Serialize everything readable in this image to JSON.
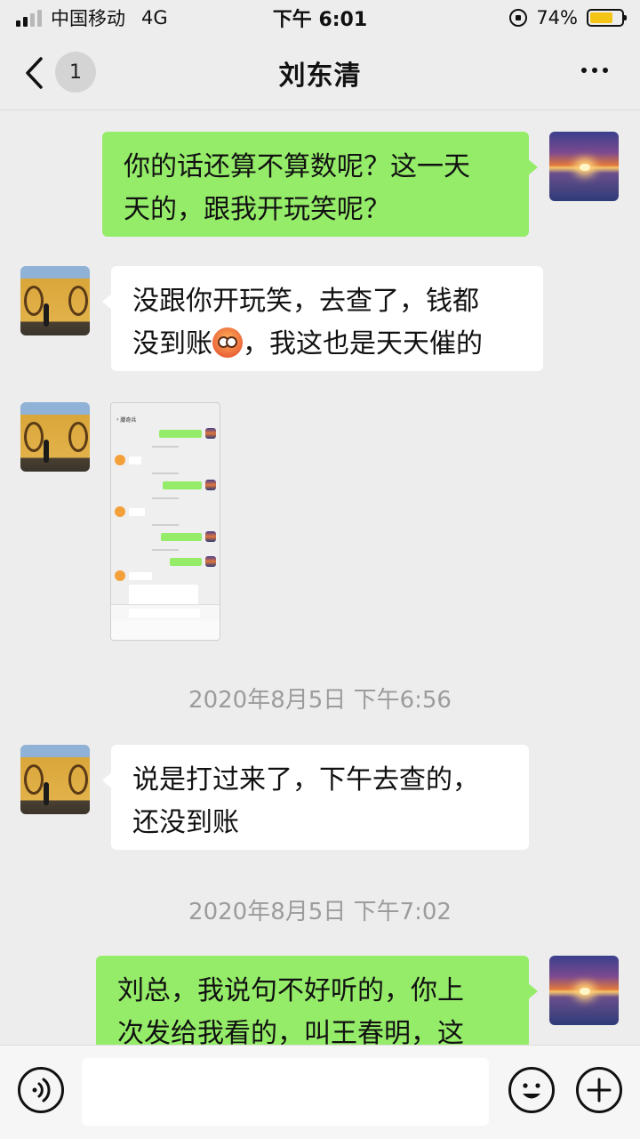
{
  "status_bar": {
    "carrier": "中国移动",
    "network": "4G",
    "time": "下午 6:01",
    "battery_percent": "74%",
    "battery_level": 0.74
  },
  "nav": {
    "title": "刘东清",
    "unread_count": "1",
    "back_icon": "chevron-left-icon",
    "more_icon": "more-dots-icon"
  },
  "messages": [
    {
      "sender": "me",
      "lines": [
        "你的话还算不算数呢？这一天",
        "天的，跟我开玩笑呢？"
      ]
    },
    {
      "sender": "other",
      "line1": "没跟你开玩笑，去查了，钱都",
      "line2_before_emoji": "没到账",
      "line2_after_emoji": "，我这也是天天催的"
    },
    {
      "sender": "other",
      "type": "image",
      "thumb_title": "滕奇兵"
    },
    {
      "sender": "other",
      "lines": [
        "说是打过来了，下午去查的，",
        "还没到账"
      ]
    },
    {
      "sender": "me",
      "lines": [
        "刘总，我说句不好听的，你上",
        "次发给我看的，叫王春明，这"
      ]
    }
  ],
  "timestamps": [
    "2020年8月5日 下午6:56",
    "2020年8月5日 下午7:02"
  ],
  "input": {
    "placeholder": ""
  },
  "colors": {
    "my_bubble": "#95ec69",
    "their_bubble": "#ffffff",
    "background": "#ededed",
    "battery": "#f4c514"
  }
}
